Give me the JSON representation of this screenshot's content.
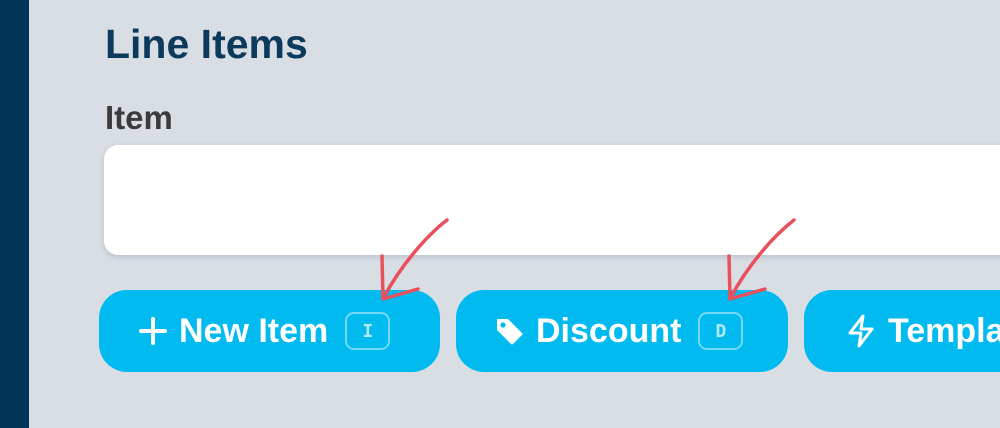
{
  "section": {
    "title": "Line Items"
  },
  "item_field": {
    "label": "Item",
    "value": "",
    "placeholder": ""
  },
  "actions": {
    "new_item": {
      "label": "New Item",
      "shortcut": "I",
      "icon": "plus-icon"
    },
    "discount": {
      "label": "Discount",
      "shortcut": "D",
      "icon": "tag-icon"
    },
    "templates": {
      "label": "Templa",
      "icon": "lightning-icon"
    }
  },
  "colors": {
    "sidebar": "#003557",
    "background": "#d9dee5",
    "title": "#0c3a5c",
    "button": "#00baf0",
    "annotation": "#e8505b"
  }
}
